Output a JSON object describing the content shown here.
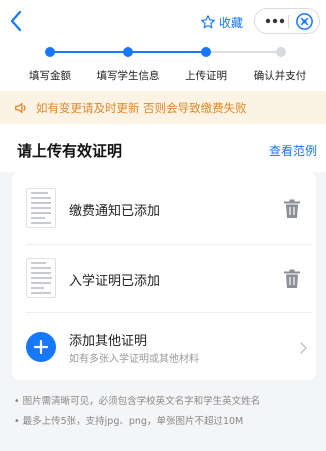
{
  "header": {
    "favorite_label": "收藏",
    "icons": [
      "back-icon",
      "star-icon",
      "more-icon",
      "close-icon"
    ],
    "accent_color": "#1677ff"
  },
  "steps": [
    {
      "label": "填写金额",
      "status": "done"
    },
    {
      "label": "填写学生信息",
      "status": "done"
    },
    {
      "label": "上传证明",
      "status": "current"
    },
    {
      "label": "确认并支付",
      "status": "todo"
    }
  ],
  "notice": {
    "text": "如有变更请及时更新 否则会导致缴费失败",
    "color": "#e0882b",
    "background": "#fdf3e4"
  },
  "section": {
    "title": "请上传有效证明",
    "example_link": "查看范例"
  },
  "uploads": [
    {
      "label": "缴费通知已添加"
    },
    {
      "label": "入学证明已添加"
    }
  ],
  "add_other": {
    "title": "添加其他证明",
    "subtitle": "如有多张入学证明或其他材料"
  },
  "hints": [
    "• 图片需清晰可见，必须包含学校英文名字和学生英文姓名",
    "• 最多上传5张，支持jpg、png，单张图片不超过10M"
  ]
}
